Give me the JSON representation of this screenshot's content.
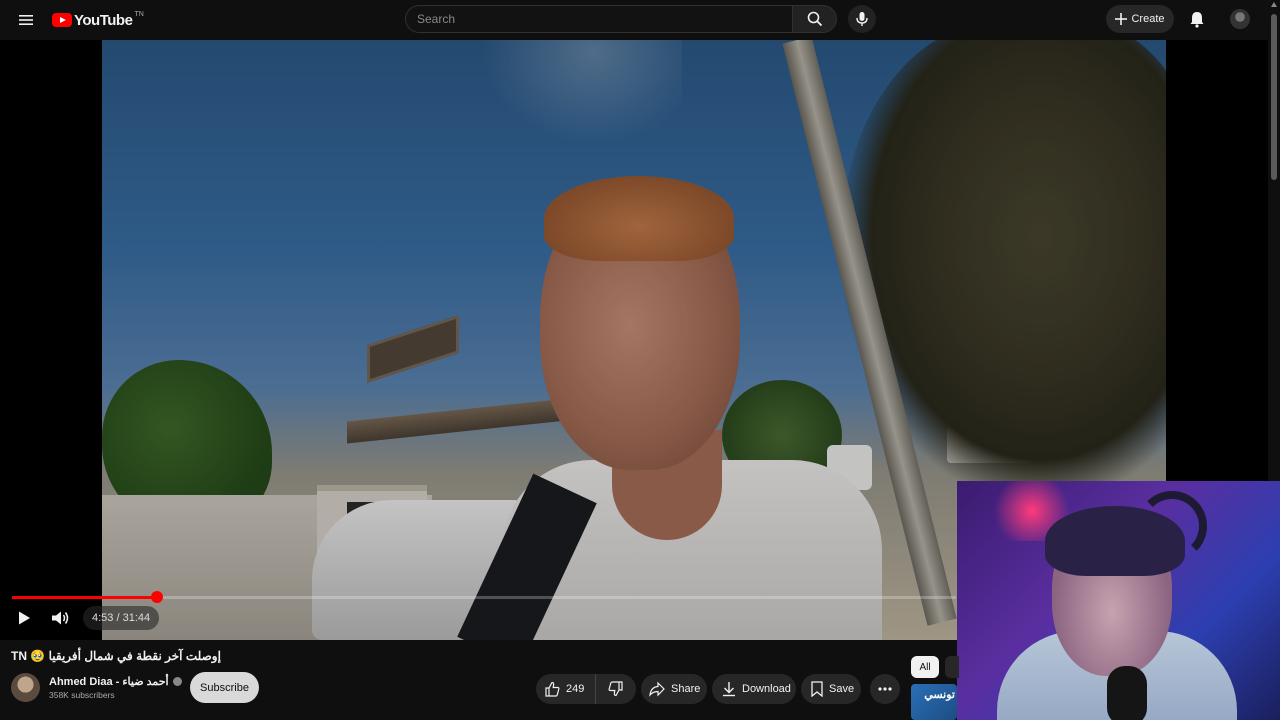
{
  "header": {
    "logo_text": "YouTube",
    "logo_country": "TN",
    "search_placeholder": "Search",
    "create_label": "Create"
  },
  "player": {
    "time": "4:53 / 31:44",
    "progress": 0.154,
    "accent_color": "#ff0000"
  },
  "video": {
    "title": "TN 🥹 إوصلت آخر نقطة في شمال أفريقيا",
    "channel_name": "Ahmed Diaa - أحمد ضياء",
    "subscribers": "358K subscribers",
    "subscribe_label": "Subscribe",
    "likes": "249",
    "share_label": "Share",
    "download_label": "Download",
    "save_label": "Save"
  },
  "sidebar": {
    "chips": [
      "All"
    ],
    "thumb_text": "تونسي"
  },
  "icons": [
    "menu-icon",
    "search-icon",
    "mic-icon",
    "plus-icon",
    "bell-icon",
    "play-icon",
    "volume-icon",
    "like-icon",
    "dislike-icon",
    "share-icon",
    "download-icon",
    "save-icon",
    "more-icon",
    "verified-icon"
  ]
}
